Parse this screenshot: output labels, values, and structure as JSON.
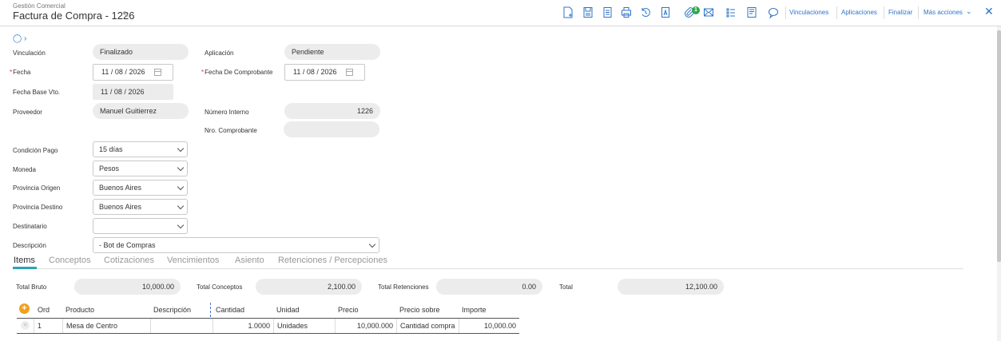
{
  "header": {
    "module": "Gestión Comercial",
    "title": "Factura de Compra - 1226"
  },
  "toolbar": {
    "icons": [
      "new-document-icon",
      "save-icon",
      "copy-icon",
      "print-icon",
      "history-icon",
      "pdf-icon",
      "attachment-icon",
      "email-icon",
      "checklist-icon",
      "notes-icon",
      "comment-icon"
    ],
    "attachment_count": "1",
    "links": {
      "vinculaciones": "Vinculaciones",
      "aplicaciones": "Aplicaciones",
      "finalizar": "Finalizar",
      "mas_acciones": "Más acciones"
    },
    "accent": "#2e74c8"
  },
  "form": {
    "vinculacion": {
      "label": "Vinculación",
      "value": "Finalizado"
    },
    "aplicacion": {
      "label": "Aplicación",
      "value": "Pendiente"
    },
    "fecha": {
      "label": "Fecha",
      "day": "11",
      "month": "08",
      "year": "2026"
    },
    "fecha_comprobante": {
      "label": "Fecha De Comprobante",
      "day": "11",
      "month": "08",
      "year": "2026"
    },
    "fecha_base_vto": {
      "label": "Fecha Base Vto.",
      "day": "11",
      "month": "08",
      "year": "2026"
    },
    "proveedor": {
      "label": "Proveedor",
      "value": "Manuel Guitierrez"
    },
    "numero_interno": {
      "label": "Número Interno",
      "value": "1226"
    },
    "nro_comprobante": {
      "label": "Nro. Comprobante",
      "value": ""
    },
    "condicion_pago": {
      "label": "Condición Pago",
      "value": "15 días"
    },
    "moneda": {
      "label": "Moneda",
      "value": "Pesos"
    },
    "provincia_origen": {
      "label": "Provincia Origen",
      "value": "Buenos Aires"
    },
    "provincia_destino": {
      "label": "Provincia Destino",
      "value": "Buenos Aires"
    },
    "destinatario": {
      "label": "Destinatario",
      "value": ""
    },
    "descripcion": {
      "label": "Descripción",
      "value": "- Bot de Compras"
    },
    "date_separator": "/"
  },
  "tabs": [
    "Items",
    "Conceptos",
    "Cotizaciones",
    "Vencimientos",
    "Asiento",
    "Retenciones / Percepciones"
  ],
  "totals": {
    "bruto": {
      "label": "Total Bruto",
      "value": "10,000.00"
    },
    "conceptos": {
      "label": "Total Conceptos",
      "value": "2,100.00"
    },
    "retenciones": {
      "label": "Total Retenciones",
      "value": "0.00"
    },
    "total": {
      "label": "Total",
      "value": "12,100.00"
    }
  },
  "grid": {
    "columns": [
      "Ord",
      "Producto",
      "Descripción",
      "Cantidad",
      "Unidad",
      "Precio",
      "Precio sobre",
      "Importe"
    ],
    "rows": [
      {
        "ord": "1",
        "producto": "Mesa de Centro",
        "descripcion": "",
        "cantidad": "1.0000",
        "unidad": "Unidades",
        "precio": "10,000.000",
        "precio_sobre": "Cantidad compra",
        "importe": "10,000.00"
      }
    ]
  }
}
